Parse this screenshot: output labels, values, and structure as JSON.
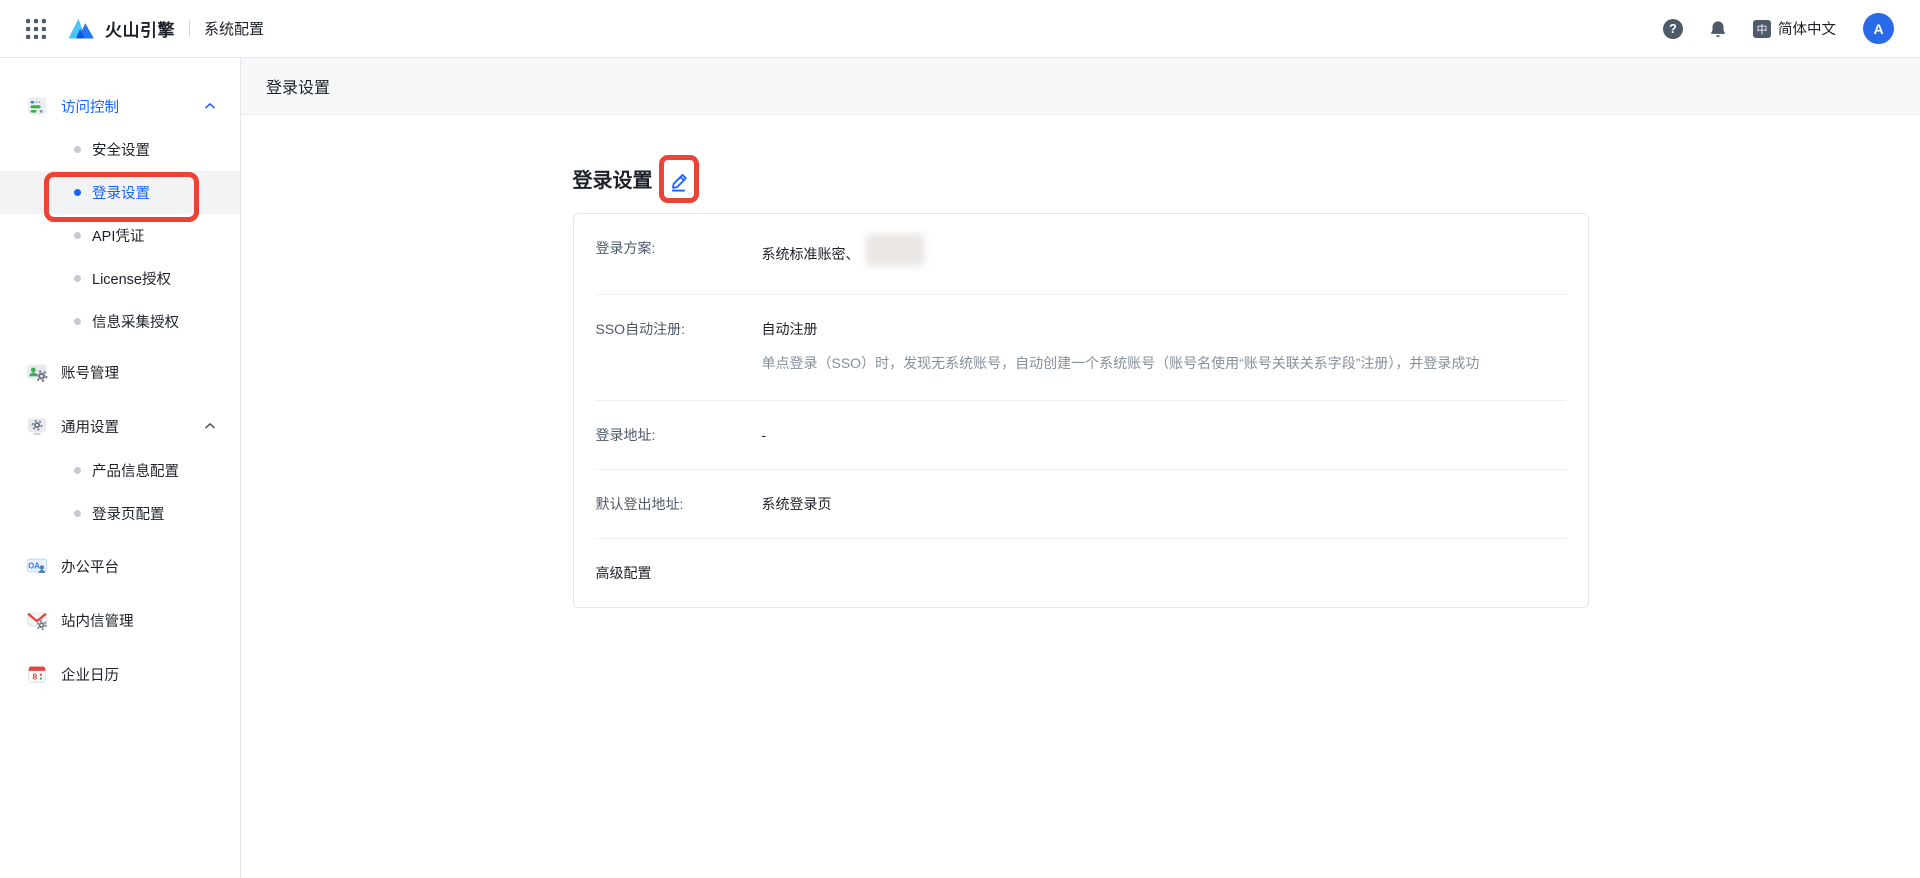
{
  "colors": {
    "accent_blue": "#1664ff",
    "annotation_red": "#ec4336",
    "topbar_icon_gray": "#4e5969",
    "selected_item_bg": "#f2f3f5",
    "page_header_bg": "#f7f8fa"
  },
  "topbar": {
    "brand": "火山引擎",
    "app_title": "系统配置",
    "language": "简体中文",
    "avatar_text": "A",
    "help_glyph": "?",
    "language_icon_glyph": "中"
  },
  "sidebar": {
    "items": [
      {
        "label": "访问控制",
        "type": "parent",
        "expanded": true,
        "active": true
      },
      {
        "label": "安全设置",
        "type": "sub"
      },
      {
        "label": "登录设置",
        "type": "sub",
        "selected": true,
        "annotated": true
      },
      {
        "label": "API凭证",
        "type": "sub"
      },
      {
        "label": "License授权",
        "type": "sub"
      },
      {
        "label": "信息采集授权",
        "type": "sub"
      },
      {
        "label": "账号管理",
        "type": "parent"
      },
      {
        "label": "通用设置",
        "type": "parent",
        "expanded": true
      },
      {
        "label": "产品信息配置",
        "type": "sub"
      },
      {
        "label": "登录页配置",
        "type": "sub"
      },
      {
        "label": "办公平台",
        "type": "parent"
      },
      {
        "label": "站内信管理",
        "type": "parent"
      },
      {
        "label": "企业日历",
        "type": "parent"
      }
    ]
  },
  "main": {
    "page_title": "登录设置",
    "section_title": "登录设置",
    "card": {
      "rows": [
        {
          "label": "登录方案:",
          "value": "系统标准账密、",
          "value_suffix_redacted": true
        },
        {
          "label": "SSO自动注册:",
          "value": "自动注册",
          "description": "单点登录（SSO）时，发现无系统账号，自动创建一个系统账号（账号名使用“账号关联关系字段”注册），并登录成功"
        },
        {
          "label": "登录地址:",
          "value": "-"
        },
        {
          "label": "默认登出地址:",
          "value": "系统登录页"
        },
        {
          "label": "高级配置"
        }
      ]
    }
  }
}
